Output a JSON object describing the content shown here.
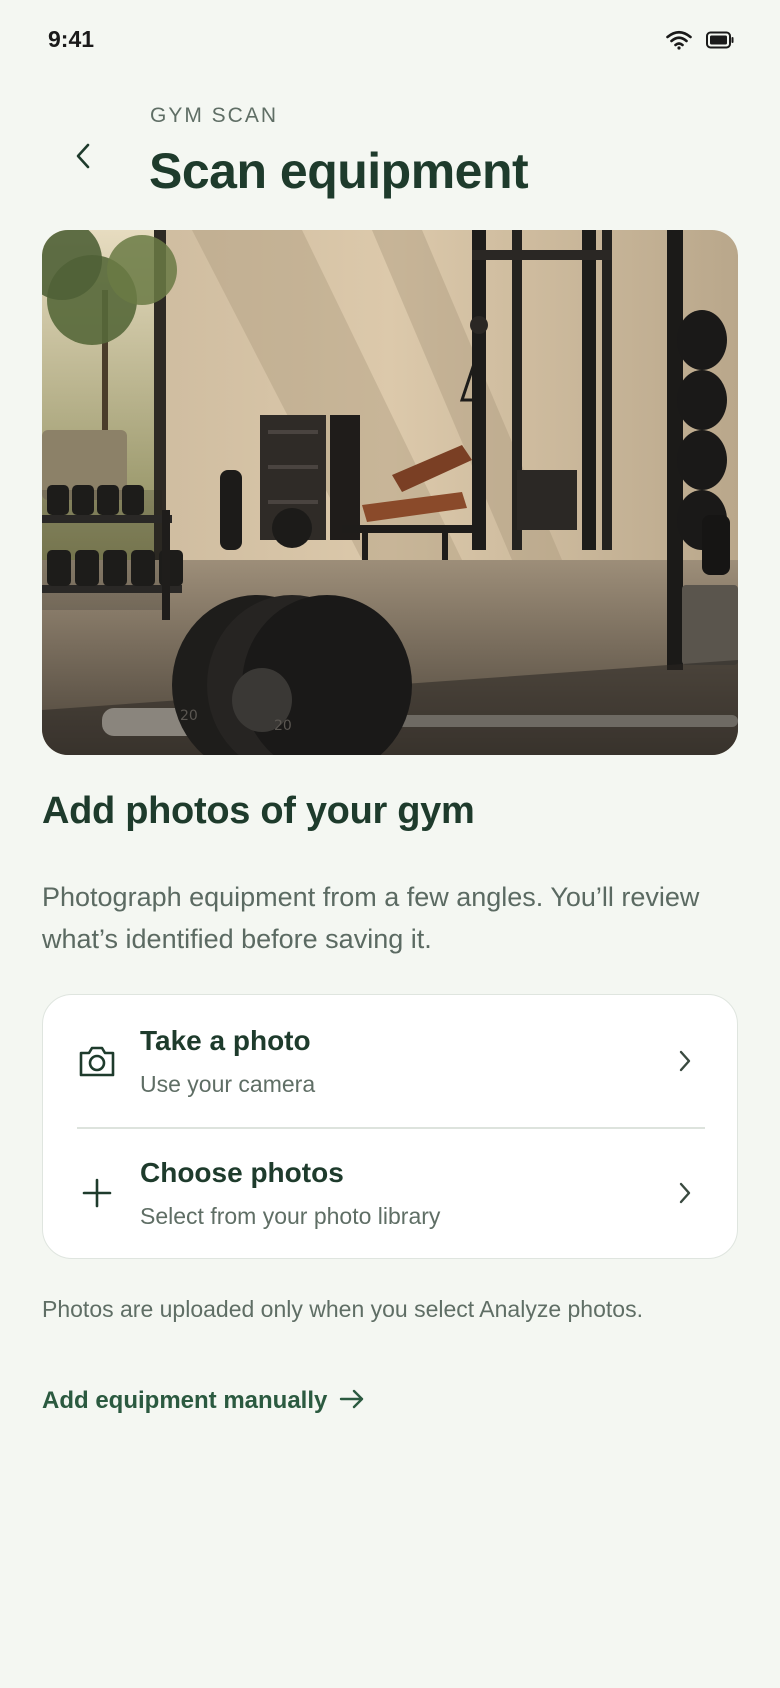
{
  "status_bar": {
    "time": "9:41",
    "icons": [
      "wifi-icon",
      "battery-icon"
    ]
  },
  "header": {
    "eyebrow": "GYM SCAN",
    "title": "Scan equipment",
    "back_icon": "chevron-left-icon"
  },
  "hero": {
    "image": "gym interior photo"
  },
  "section": {
    "title": "Add photos of your gym",
    "description": "Photograph equipment from a few angles. You’ll review what’s identified before saving it."
  },
  "options": [
    {
      "title": "Take a photo",
      "subtitle": "Use your camera",
      "icon": "camera-icon"
    },
    {
      "title": "Choose photos",
      "subtitle": "Select from your photo library",
      "icon": "plus-icon"
    }
  ],
  "privacy_note": "Photos are uploaded only when you select Analyze photos.",
  "manual_link": {
    "label": "Add equipment manually",
    "icon": "arrow-right-icon"
  },
  "colors": {
    "background": "#f4f7f2",
    "primary": "#1e3b2c",
    "link": "#2b5a40",
    "muted": "#5f6e65"
  }
}
